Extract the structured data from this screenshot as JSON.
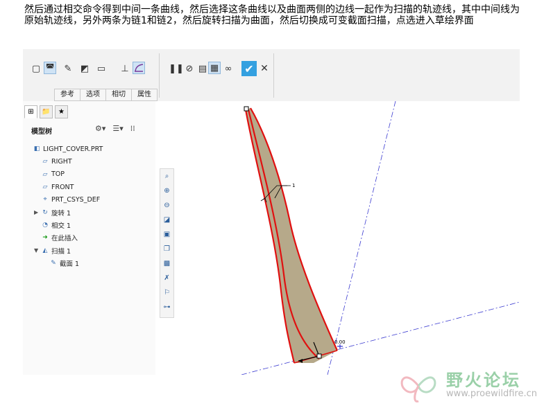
{
  "caption": "然后通过相交命令得到中间一条曲线，然后选择这条曲线以及曲面两侧的边线一起作为扫描的轨迹线，其中中间线为原始轨迹线，另外两条为链1和链2，然后旋转扫描为曲面，然后切换成可变截面扫描，点选进入草绘界面",
  "ribbon": {
    "tabs": [
      "参考",
      "选项",
      "相切",
      "属性"
    ]
  },
  "model_tree": {
    "header": "模型树",
    "items": [
      {
        "label": "LIGHT_COVER.PRT",
        "icon": "part-icon",
        "indent": 0,
        "expand": ""
      },
      {
        "label": "RIGHT",
        "icon": "datum-plane-icon",
        "indent": 1,
        "expand": ""
      },
      {
        "label": "TOP",
        "icon": "datum-plane-icon",
        "indent": 1,
        "expand": ""
      },
      {
        "label": "FRONT",
        "icon": "datum-plane-icon",
        "indent": 1,
        "expand": ""
      },
      {
        "label": "PRT_CSYS_DEF",
        "icon": "csys-icon",
        "indent": 1,
        "expand": ""
      },
      {
        "label": "旋转 1",
        "icon": "revolve-icon",
        "indent": 1,
        "expand": "▶"
      },
      {
        "label": "相交 1",
        "icon": "intersect-icon",
        "indent": 1,
        "expand": ""
      },
      {
        "label": "在此插入",
        "icon": "insert-here-icon",
        "indent": 1,
        "expand": ""
      },
      {
        "label": "扫描 1",
        "icon": "sweep-icon",
        "indent": 1,
        "expand": "▼"
      },
      {
        "label": "截面 1",
        "icon": "section-icon",
        "indent": 2,
        "expand": ""
      }
    ]
  },
  "graphics": {
    "dim_value_1": "1",
    "dim_value_2": "0.00"
  },
  "watermark": {
    "title": "野火论坛",
    "url": "www.proewildfire.cn"
  },
  "colors": {
    "surface_fill": "#b6a98a",
    "trajectory_red": "#e01010",
    "datum_blue": "#3a3ad0",
    "accent": "#2f8fd8"
  }
}
